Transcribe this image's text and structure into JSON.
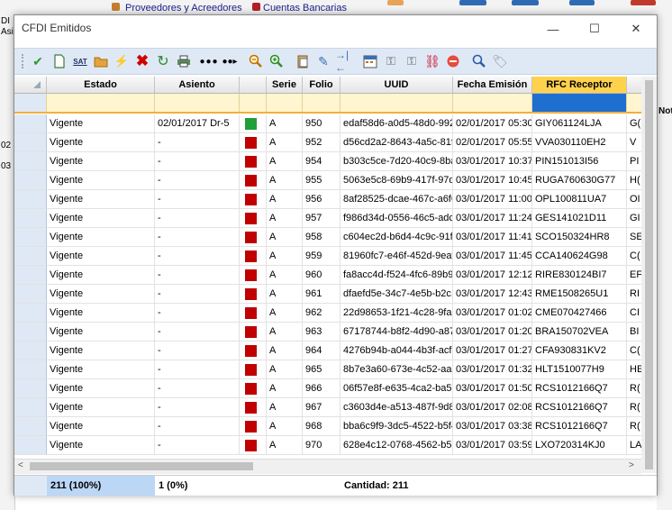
{
  "background": {
    "top_items": [
      "Proveedores y Acreedores",
      "Cuentas Bancarias"
    ],
    "left_fragments": [
      "DI",
      "Asi",
      "02",
      "03"
    ],
    "right_fragments": [
      "Nota"
    ]
  },
  "window": {
    "title": "CFDI Emitidos",
    "minimize": "—",
    "maximize": "☐",
    "close": "✕"
  },
  "toolbar": {
    "sat_label": "SAT",
    "icons": [
      "check-icon",
      "new-document-icon",
      "sat-icon",
      "open-folder-icon",
      "pdf-icon",
      "delete-icon",
      "refresh-icon",
      "print-icon",
      "dots-icon",
      "dots-right-icon",
      "zoom-out-icon",
      "zoom-in-icon",
      "paste-icon",
      "edit-icon",
      "split-icon",
      "calendar-icon",
      "key-icon",
      "key-alt-icon",
      "link-icon",
      "cancel-icon",
      "search-icon",
      "tag-icon"
    ]
  },
  "grid": {
    "columns": [
      "",
      "Estado",
      "Asiento",
      "",
      "Serie",
      "Folio",
      "UUID",
      "Fecha Emisión",
      "RFC Receptor",
      ""
    ],
    "rows": [
      {
        "estado": "Vigente",
        "asiento": "02/01/2017 Dr-5",
        "status": "green",
        "serie": "A",
        "folio": "950",
        "uuid": "edaf58d6-a0d5-48d0-992",
        "fecha": "02/01/2017 05:30",
        "rfc": "GIY061124LJA",
        "extra": "G("
      },
      {
        "estado": "Vigente",
        "asiento": "-",
        "status": "red",
        "serie": "A",
        "folio": "952",
        "uuid": "d56cd2a2-8643-4a5c-81fl",
        "fecha": "02/01/2017 05:55",
        "rfc": "VVA030110EH2",
        "extra": "V"
      },
      {
        "estado": "Vigente",
        "asiento": "-",
        "status": "red",
        "serie": "A",
        "folio": "954",
        "uuid": "b303c5ce-7d20-40c9-8ba",
        "fecha": "03/01/2017 10:37",
        "rfc": "PIN151013I56",
        "extra": "PI"
      },
      {
        "estado": "Vigente",
        "asiento": "-",
        "status": "red",
        "serie": "A",
        "folio": "955",
        "uuid": "5063e5c8-69b9-417f-97d",
        "fecha": "03/01/2017 10:45",
        "rfc": "RUGA760630G77",
        "extra": "H("
      },
      {
        "estado": "Vigente",
        "asiento": "-",
        "status": "red",
        "serie": "A",
        "folio": "956",
        "uuid": "8af28525-dcae-467c-a6f6",
        "fecha": "03/01/2017 11:00",
        "rfc": "OPL100811UA7",
        "extra": "OI"
      },
      {
        "estado": "Vigente",
        "asiento": "-",
        "status": "red",
        "serie": "A",
        "folio": "957",
        "uuid": "f986d34d-0556-46c5-adc",
        "fecha": "03/01/2017 11:24",
        "rfc": "GES141021D11",
        "extra": "GI"
      },
      {
        "estado": "Vigente",
        "asiento": "-",
        "status": "red",
        "serie": "A",
        "folio": "958",
        "uuid": "c604ec2d-b6d4-4c9c-91fa",
        "fecha": "03/01/2017 11:41",
        "rfc": "SCO150324HR8",
        "extra": "SE"
      },
      {
        "estado": "Vigente",
        "asiento": "-",
        "status": "red",
        "serie": "A",
        "folio": "959",
        "uuid": "81960fc7-e46f-452d-9eat",
        "fecha": "03/01/2017 11:45",
        "rfc": "CCA140624G98",
        "extra": "C("
      },
      {
        "estado": "Vigente",
        "asiento": "-",
        "status": "red",
        "serie": "A",
        "folio": "960",
        "uuid": "fa8acc4d-f524-4fc6-89b9-",
        "fecha": "03/01/2017 12:12",
        "rfc": "RIRE830124BI7",
        "extra": "EF"
      },
      {
        "estado": "Vigente",
        "asiento": "-",
        "status": "red",
        "serie": "A",
        "folio": "961",
        "uuid": "dfaefd5e-34c7-4e5b-b2c1",
        "fecha": "03/01/2017 12:43",
        "rfc": "RME1508265U1",
        "extra": "RI"
      },
      {
        "estado": "Vigente",
        "asiento": "-",
        "status": "red",
        "serie": "A",
        "folio": "962",
        "uuid": "22d98653-1f21-4c28-9fal",
        "fecha": "03/01/2017 01:02",
        "rfc": "CME070427466",
        "extra": "CI"
      },
      {
        "estado": "Vigente",
        "asiento": "-",
        "status": "red",
        "serie": "A",
        "folio": "963",
        "uuid": "67178744-b8f2-4d90-a87",
        "fecha": "03/01/2017 01:20",
        "rfc": "BRA150702VEA",
        "extra": "BI"
      },
      {
        "estado": "Vigente",
        "asiento": "-",
        "status": "red",
        "serie": "A",
        "folio": "964",
        "uuid": "4276b94b-a044-4b3f-acf2",
        "fecha": "03/01/2017 01:27",
        "rfc": "CFA930831KV2",
        "extra": "C("
      },
      {
        "estado": "Vigente",
        "asiento": "-",
        "status": "red",
        "serie": "A",
        "folio": "965",
        "uuid": "8b7e3a60-673e-4c52-aa8",
        "fecha": "03/01/2017 01:32",
        "rfc": "HLT1510077H9",
        "extra": "HE"
      },
      {
        "estado": "Vigente",
        "asiento": "-",
        "status": "red",
        "serie": "A",
        "folio": "966",
        "uuid": "06f57e8f-e635-4ca2-ba56",
        "fecha": "03/01/2017 01:50",
        "rfc": "RCS1012166Q7",
        "extra": "R("
      },
      {
        "estado": "Vigente",
        "asiento": "-",
        "status": "red",
        "serie": "A",
        "folio": "967",
        "uuid": "c3603d4e-a513-487f-9d8",
        "fecha": "03/01/2017 02:08",
        "rfc": "RCS1012166Q7",
        "extra": "R("
      },
      {
        "estado": "Vigente",
        "asiento": "-",
        "status": "red",
        "serie": "A",
        "folio": "968",
        "uuid": "bba6c9f9-3dc5-4522-b5f4",
        "fecha": "03/01/2017 03:38",
        "rfc": "RCS1012166Q7",
        "extra": "R("
      },
      {
        "estado": "Vigente",
        "asiento": "-",
        "status": "red",
        "serie": "A",
        "folio": "970",
        "uuid": "628e4c12-0768-4562-b55",
        "fecha": "03/01/2017 03:59",
        "rfc": "LXO720314KJ0",
        "extra": "LA"
      }
    ]
  },
  "status_bar": {
    "count_pct": "211 (100%)",
    "asiento_pct": "1 (0%)",
    "cantidad": "Cantidad: 211"
  },
  "colors": {
    "status_green": "#1f9e3a",
    "status_red": "#c00000",
    "selected_header": "#ffd24d",
    "selected_filter": "#1f6fd1",
    "status_highlight": "#bcd7f5"
  }
}
